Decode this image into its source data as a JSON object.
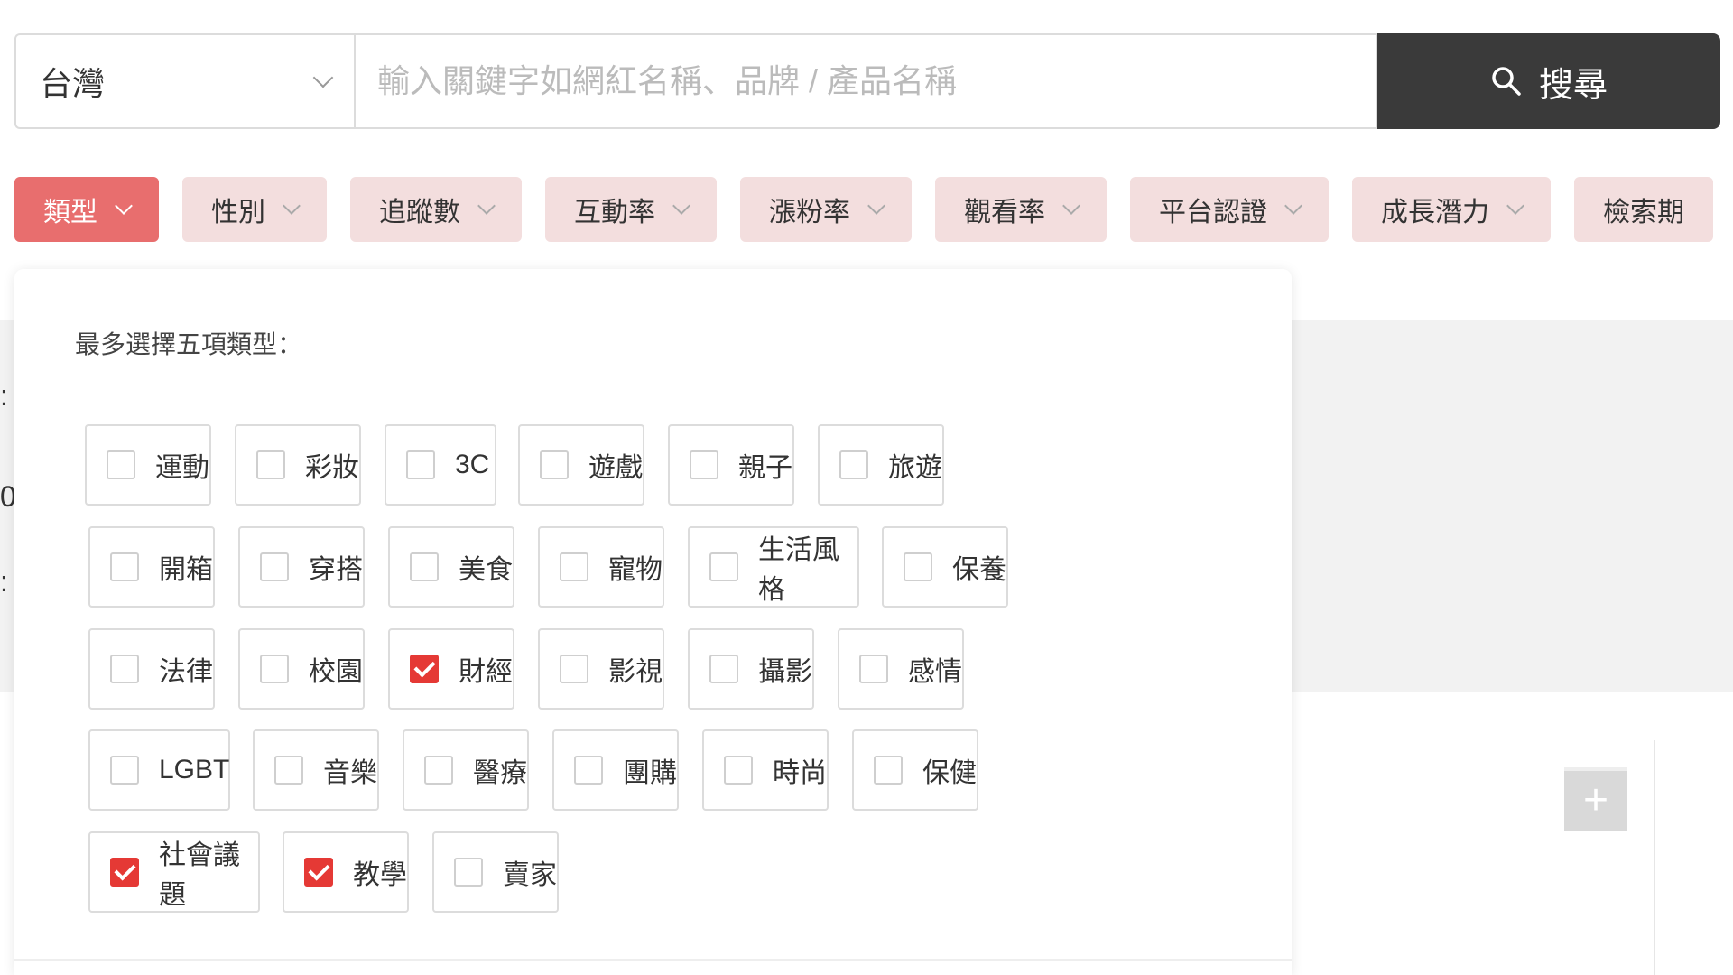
{
  "search": {
    "region": "台灣",
    "placeholder": "輸入關鍵字如網紅名稱、品牌 / 產品名稱",
    "button_label": "搜尋"
  },
  "filters": [
    {
      "label": "類型",
      "active": true
    },
    {
      "label": "性別",
      "active": false
    },
    {
      "label": "追蹤數",
      "active": false
    },
    {
      "label": "互動率",
      "active": false
    },
    {
      "label": "漲粉率",
      "active": false
    },
    {
      "label": "觀看率",
      "active": false
    },
    {
      "label": "平台認證",
      "active": false
    },
    {
      "label": "成長潛力",
      "active": false
    },
    {
      "label": "檢索期",
      "active": false
    }
  ],
  "category_panel": {
    "title": "最多選擇五項類型：",
    "options": [
      {
        "label": "運動",
        "checked": false
      },
      {
        "label": "彩妝",
        "checked": false
      },
      {
        "label": "3C",
        "checked": false
      },
      {
        "label": "遊戲",
        "checked": false
      },
      {
        "label": "親子",
        "checked": false
      },
      {
        "label": "旅遊",
        "checked": false
      },
      {
        "label": "開箱",
        "checked": false
      },
      {
        "label": "穿搭",
        "checked": false
      },
      {
        "label": "美食",
        "checked": false
      },
      {
        "label": "寵物",
        "checked": false
      },
      {
        "label": "生活風格",
        "checked": false
      },
      {
        "label": "保養",
        "checked": false
      },
      {
        "label": "法律",
        "checked": false
      },
      {
        "label": "校園",
        "checked": false
      },
      {
        "label": "財經",
        "checked": true
      },
      {
        "label": "影視",
        "checked": false
      },
      {
        "label": "攝影",
        "checked": false
      },
      {
        "label": "感情",
        "checked": false
      },
      {
        "label": "LGBT",
        "checked": false
      },
      {
        "label": "音樂",
        "checked": false
      },
      {
        "label": "醫療",
        "checked": false
      },
      {
        "label": "團購",
        "checked": false
      },
      {
        "label": "時尚",
        "checked": false
      },
      {
        "label": "保健",
        "checked": false
      },
      {
        "label": "社會議題",
        "checked": true
      },
      {
        "label": "教學",
        "checked": true
      },
      {
        "label": "賣家",
        "checked": false
      }
    ]
  },
  "background": {
    "partial_glyphs": [
      ":",
      "0",
      ":"
    ],
    "add_icon": "plus-icon"
  },
  "colors": {
    "accent": "#e86e6e",
    "checked": "#e53935",
    "filter_bg": "#f3dede",
    "search_button": "#3a3a3a"
  }
}
